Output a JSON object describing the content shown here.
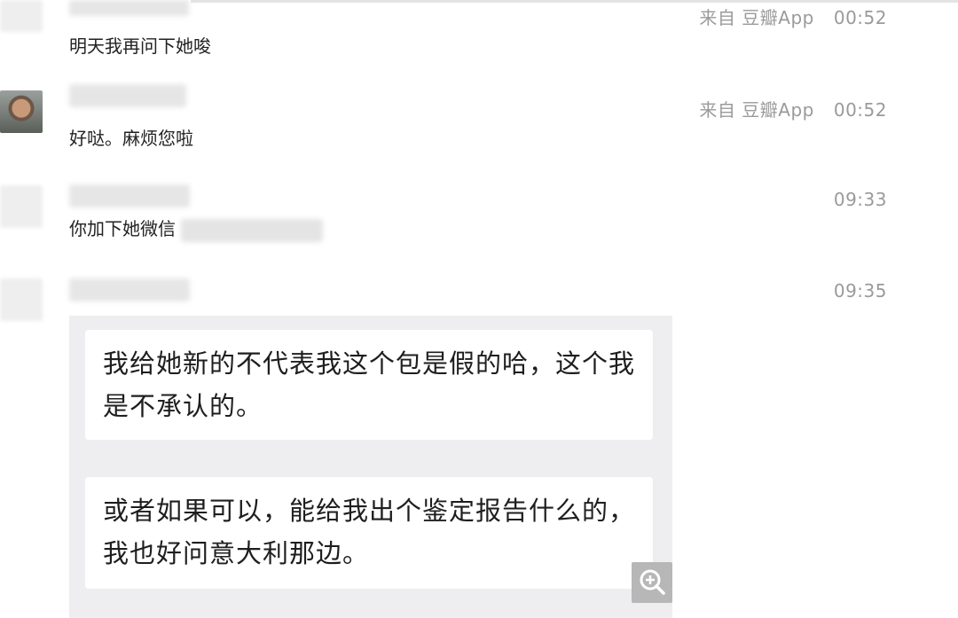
{
  "messages": [
    {
      "text": "明天我再问下她唆",
      "source": "来自 豆瓣App",
      "time": "00:52"
    },
    {
      "text": "好哒。麻烦您啦",
      "source": "来自 豆瓣App",
      "time": "00:52"
    },
    {
      "text": "你加下她微信",
      "source": "",
      "time": "09:33"
    },
    {
      "text": "",
      "source": "",
      "time": "09:35"
    }
  ],
  "quoted": {
    "bubbles": [
      {
        "text": "我给她新的不代表我这个包是假的哈，这个我是不承认的。"
      },
      {
        "text": "或者如果可以，能给我出个鉴定报告什么的，我也好问意大利那边。"
      }
    ]
  },
  "icons": {
    "zoom": "zoom-in-icon"
  },
  "colors": {
    "meta_text": "#9a9a9a",
    "quote_panel": "#eeeef0",
    "zoom_button": "#b7b7b7"
  }
}
